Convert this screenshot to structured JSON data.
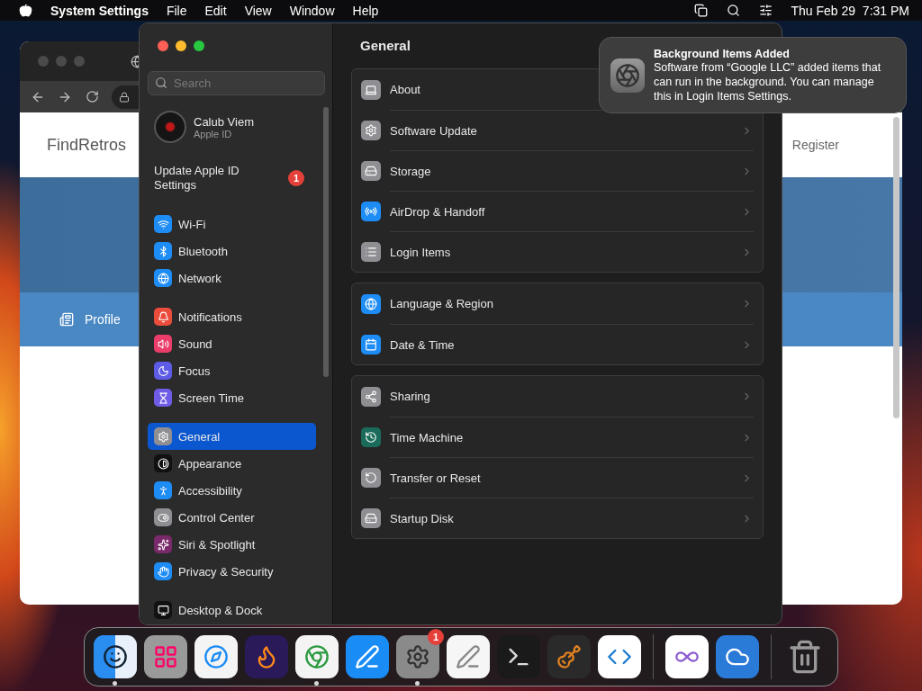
{
  "menu_bar": {
    "app": "System Settings",
    "menus": [
      "File",
      "Edit",
      "View",
      "Window",
      "Help"
    ],
    "clock": "Thu Feb 29  7:31 PM"
  },
  "browser": {
    "site_title": "FindRetros",
    "nav_link": "Register",
    "tab": "Profile"
  },
  "settings": {
    "search": {
      "placeholder": "Search"
    },
    "account": {
      "name": "Calub Viem",
      "subtitle": "Apple ID"
    },
    "alert": {
      "label": "Update Apple ID Settings",
      "badge": "1"
    },
    "sidebar": [
      {
        "items": [
          {
            "label": "Wi-Fi",
            "kind": "wifi",
            "selected": false
          },
          {
            "label": "Bluetooth",
            "kind": "bluetooth",
            "selected": false
          },
          {
            "label": "Network",
            "kind": "network",
            "selected": false
          }
        ]
      },
      {
        "items": [
          {
            "label": "Notifications",
            "kind": "notifications",
            "selected": false
          },
          {
            "label": "Sound",
            "kind": "sound",
            "selected": false
          },
          {
            "label": "Focus",
            "kind": "focus",
            "selected": false
          },
          {
            "label": "Screen Time",
            "kind": "screentime",
            "selected": false
          }
        ]
      },
      {
        "items": [
          {
            "label": "General",
            "kind": "general",
            "selected": true
          },
          {
            "label": "Appearance",
            "kind": "appearance",
            "selected": false
          },
          {
            "label": "Accessibility",
            "kind": "accessibility",
            "selected": false
          },
          {
            "label": "Control Center",
            "kind": "control",
            "selected": false
          },
          {
            "label": "Siri & Spotlight",
            "kind": "siri",
            "selected": false
          },
          {
            "label": "Privacy & Security",
            "kind": "privacy",
            "selected": false
          }
        ]
      },
      {
        "items": [
          {
            "label": "Desktop & Dock",
            "kind": "desktop",
            "selected": false
          }
        ]
      }
    ],
    "title": "General",
    "groups": [
      {
        "rows": [
          {
            "label": "About",
            "kind": "about"
          },
          {
            "label": "Software Update",
            "kind": "update"
          },
          {
            "label": "Storage",
            "kind": "storage"
          },
          {
            "label": "AirDrop & Handoff",
            "kind": "airdrop"
          },
          {
            "label": "Login Items",
            "kind": "login"
          }
        ]
      },
      {
        "rows": [
          {
            "label": "Language & Region",
            "kind": "language"
          },
          {
            "label": "Date & Time",
            "kind": "date"
          }
        ]
      },
      {
        "rows": [
          {
            "label": "Sharing",
            "kind": "sharing"
          },
          {
            "label": "Time Machine",
            "kind": "timemachine"
          },
          {
            "label": "Transfer or Reset",
            "kind": "reset"
          },
          {
            "label": "Startup Disk",
            "kind": "disk"
          }
        ]
      }
    ]
  },
  "notification": {
    "title": "Background Items Added",
    "body": "Software from “Google LLC” added items that can run in the background. You can manage this in Login Items Settings."
  },
  "dock": {
    "items": [
      {
        "kind": "finder",
        "running": true
      },
      {
        "kind": "launchpad",
        "running": false
      },
      {
        "kind": "safari",
        "running": false
      },
      {
        "kind": "firefox",
        "running": false
      },
      {
        "kind": "chrome",
        "running": true
      },
      {
        "kind": "appstore",
        "running": false
      },
      {
        "kind": "settings",
        "running": true,
        "badge": "1"
      },
      {
        "kind": "textedit",
        "running": false
      },
      {
        "kind": "terminal",
        "running": false
      },
      {
        "kind": "garageband",
        "running": false
      },
      {
        "kind": "vscode",
        "running": false
      },
      {
        "kind": "separator"
      },
      {
        "kind": "vstudio",
        "running": false
      },
      {
        "kind": "weather",
        "running": false
      },
      {
        "kind": "separator"
      },
      {
        "kind": "trash",
        "running": false
      }
    ]
  }
}
